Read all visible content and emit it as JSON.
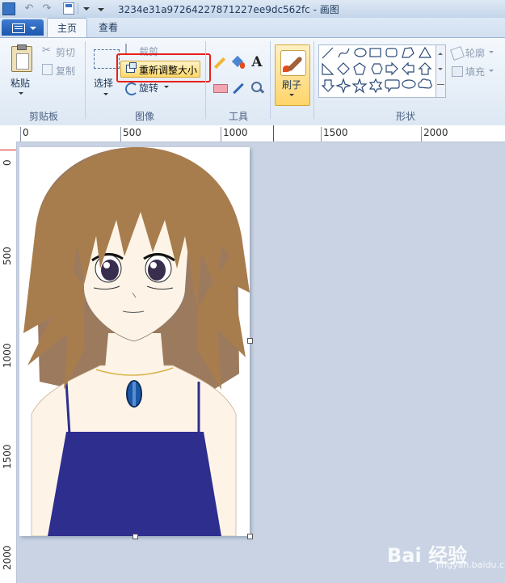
{
  "window": {
    "title": "3234e31a97264227871227ee9dc562fc - 画图"
  },
  "tabs": [
    {
      "label": "主页"
    },
    {
      "label": "查看"
    }
  ],
  "clipboard": {
    "paste_label": "粘贴",
    "cut_label": "剪切",
    "copy_label": "复制",
    "group_label": "剪贴板"
  },
  "image": {
    "select_label": "选择",
    "crop_label": "裁剪",
    "resize_label": "重新调整大小",
    "rotate_label": "旋转",
    "group_label": "图像"
  },
  "tools": {
    "group_label": "工具",
    "text_glyph": "A"
  },
  "brush": {
    "label": "刷子"
  },
  "shapes": {
    "group_label": "形状",
    "outline_label": "轮廓",
    "fill_label": "填充"
  },
  "ruler": {
    "horizontal": [
      "0",
      "500",
      "1000",
      "1500",
      "2000"
    ],
    "vertical": [
      "0",
      "500",
      "1000",
      "1500",
      "2000"
    ]
  },
  "watermark": {
    "text": "Bai 经验",
    "sub": "jingyan.baidu.com"
  },
  "colors": {
    "highlight": "#e8211a",
    "hair": "#a87d4e",
    "dress": "#2e2e8f",
    "skin": "#fdf4e7"
  }
}
